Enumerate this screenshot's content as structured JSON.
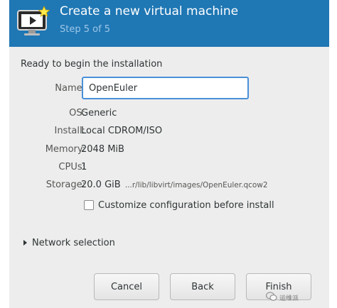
{
  "header": {
    "title": "Create a new virtual machine",
    "step": "Step 5 of 5"
  },
  "summary": {
    "ready_text": "Ready to begin the installation",
    "name_label": "Name:",
    "name_value": "OpenEuler",
    "os_label": "OS:",
    "os_value": "Generic",
    "install_label": "Install:",
    "install_value": "Local CDROM/ISO",
    "memory_label": "Memory:",
    "memory_value": "2048 MiB",
    "cpus_label": "CPUs:",
    "cpus_value": "1",
    "storage_label": "Storage:",
    "storage_size": "20.0 GiB",
    "storage_path": "...r/lib/libvirt/images/OpenEuler.qcow2"
  },
  "customize": {
    "label": "Customize configuration before install",
    "checked": false
  },
  "network": {
    "label": "Network selection",
    "expanded": false
  },
  "buttons": {
    "cancel": "Cancel",
    "back": "Back",
    "finish": "Finish"
  },
  "watermark": {
    "text": "运维派"
  },
  "colors": {
    "header_bg": "#1f77b4",
    "dialog_bg": "#ededed",
    "focus_border": "#4a90d9"
  },
  "icons": {
    "header": "monitor-with-star-icon",
    "network_expander": "triangle-right-icon",
    "watermark": "wechat-icon"
  }
}
